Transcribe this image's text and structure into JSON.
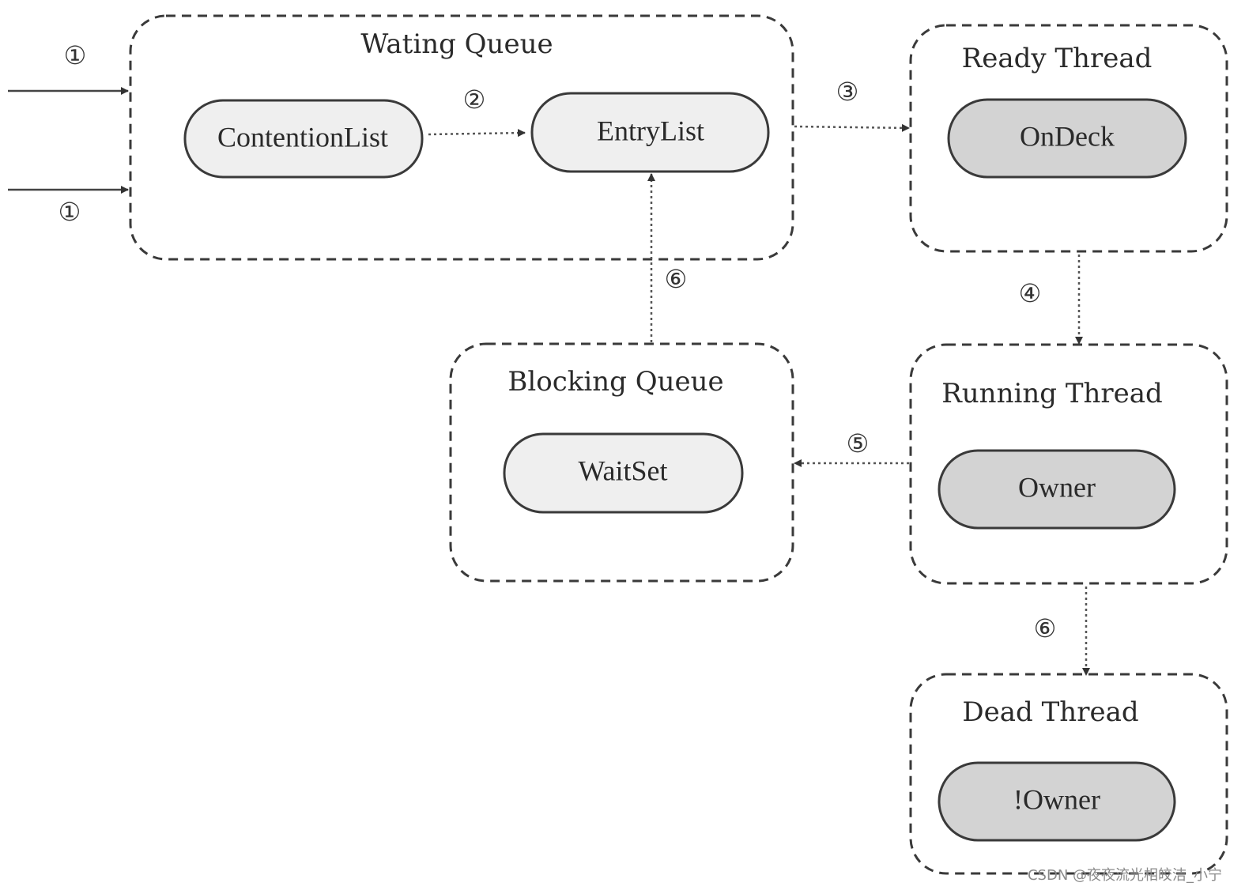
{
  "groups": {
    "waiting_queue": {
      "title": "Wating Queue",
      "items": [
        "ContentionList",
        "EntryList"
      ]
    },
    "ready_thread": {
      "title": "Ready Thread",
      "items": [
        "OnDeck"
      ]
    },
    "running_thread": {
      "title": "Running Thread",
      "items": [
        "Owner"
      ]
    },
    "blocking_queue": {
      "title": "Blocking Queue",
      "items": [
        "WaitSet"
      ]
    },
    "dead_thread": {
      "title": "Dead Thread",
      "items": [
        "!Owner"
      ]
    }
  },
  "steps": {
    "s1": "①",
    "s2": "②",
    "s3": "③",
    "s4": "④",
    "s5": "⑤",
    "s6": "⑥"
  },
  "colors": {
    "light_node": "#efefef",
    "dark_node": "#d3d3d3",
    "stroke": "#3a3a3a"
  },
  "watermark": "CSDN @夜夜流光相皎洁_小宁"
}
